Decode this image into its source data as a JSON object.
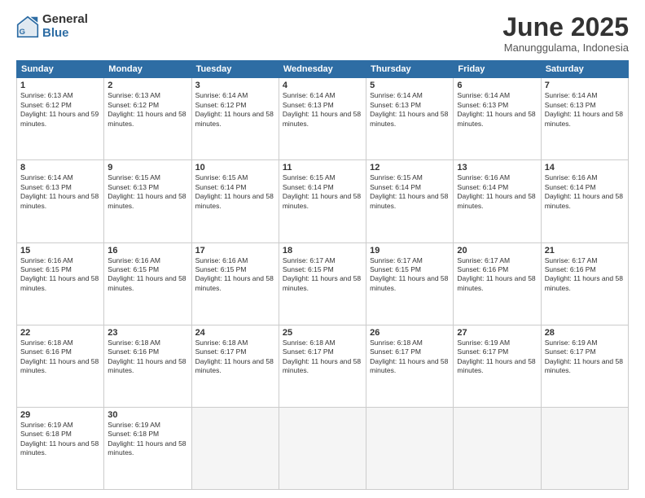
{
  "logo": {
    "general": "General",
    "blue": "Blue"
  },
  "title": "June 2025",
  "location": "Manunggulama, Indonesia",
  "days_of_week": [
    "Sunday",
    "Monday",
    "Tuesday",
    "Wednesday",
    "Thursday",
    "Friday",
    "Saturday"
  ],
  "weeks": [
    [
      {
        "num": "1",
        "rise": "6:13 AM",
        "set": "6:12 PM",
        "daylight": "11 hours and 59 minutes."
      },
      {
        "num": "2",
        "rise": "6:13 AM",
        "set": "6:12 PM",
        "daylight": "11 hours and 58 minutes."
      },
      {
        "num": "3",
        "rise": "6:14 AM",
        "set": "6:12 PM",
        "daylight": "11 hours and 58 minutes."
      },
      {
        "num": "4",
        "rise": "6:14 AM",
        "set": "6:13 PM",
        "daylight": "11 hours and 58 minutes."
      },
      {
        "num": "5",
        "rise": "6:14 AM",
        "set": "6:13 PM",
        "daylight": "11 hours and 58 minutes."
      },
      {
        "num": "6",
        "rise": "6:14 AM",
        "set": "6:13 PM",
        "daylight": "11 hours and 58 minutes."
      },
      {
        "num": "7",
        "rise": "6:14 AM",
        "set": "6:13 PM",
        "daylight": "11 hours and 58 minutes."
      }
    ],
    [
      {
        "num": "8",
        "rise": "6:14 AM",
        "set": "6:13 PM",
        "daylight": "11 hours and 58 minutes."
      },
      {
        "num": "9",
        "rise": "6:15 AM",
        "set": "6:13 PM",
        "daylight": "11 hours and 58 minutes."
      },
      {
        "num": "10",
        "rise": "6:15 AM",
        "set": "6:14 PM",
        "daylight": "11 hours and 58 minutes."
      },
      {
        "num": "11",
        "rise": "6:15 AM",
        "set": "6:14 PM",
        "daylight": "11 hours and 58 minutes."
      },
      {
        "num": "12",
        "rise": "6:15 AM",
        "set": "6:14 PM",
        "daylight": "11 hours and 58 minutes."
      },
      {
        "num": "13",
        "rise": "6:16 AM",
        "set": "6:14 PM",
        "daylight": "11 hours and 58 minutes."
      },
      {
        "num": "14",
        "rise": "6:16 AM",
        "set": "6:14 PM",
        "daylight": "11 hours and 58 minutes."
      }
    ],
    [
      {
        "num": "15",
        "rise": "6:16 AM",
        "set": "6:15 PM",
        "daylight": "11 hours and 58 minutes."
      },
      {
        "num": "16",
        "rise": "6:16 AM",
        "set": "6:15 PM",
        "daylight": "11 hours and 58 minutes."
      },
      {
        "num": "17",
        "rise": "6:16 AM",
        "set": "6:15 PM",
        "daylight": "11 hours and 58 minutes."
      },
      {
        "num": "18",
        "rise": "6:17 AM",
        "set": "6:15 PM",
        "daylight": "11 hours and 58 minutes."
      },
      {
        "num": "19",
        "rise": "6:17 AM",
        "set": "6:15 PM",
        "daylight": "11 hours and 58 minutes."
      },
      {
        "num": "20",
        "rise": "6:17 AM",
        "set": "6:16 PM",
        "daylight": "11 hours and 58 minutes."
      },
      {
        "num": "21",
        "rise": "6:17 AM",
        "set": "6:16 PM",
        "daylight": "11 hours and 58 minutes."
      }
    ],
    [
      {
        "num": "22",
        "rise": "6:18 AM",
        "set": "6:16 PM",
        "daylight": "11 hours and 58 minutes."
      },
      {
        "num": "23",
        "rise": "6:18 AM",
        "set": "6:16 PM",
        "daylight": "11 hours and 58 minutes."
      },
      {
        "num": "24",
        "rise": "6:18 AM",
        "set": "6:17 PM",
        "daylight": "11 hours and 58 minutes."
      },
      {
        "num": "25",
        "rise": "6:18 AM",
        "set": "6:17 PM",
        "daylight": "11 hours and 58 minutes."
      },
      {
        "num": "26",
        "rise": "6:18 AM",
        "set": "6:17 PM",
        "daylight": "11 hours and 58 minutes."
      },
      {
        "num": "27",
        "rise": "6:19 AM",
        "set": "6:17 PM",
        "daylight": "11 hours and 58 minutes."
      },
      {
        "num": "28",
        "rise": "6:19 AM",
        "set": "6:17 PM",
        "daylight": "11 hours and 58 minutes."
      }
    ],
    [
      {
        "num": "29",
        "rise": "6:19 AM",
        "set": "6:18 PM",
        "daylight": "11 hours and 58 minutes."
      },
      {
        "num": "30",
        "rise": "6:19 AM",
        "set": "6:18 PM",
        "daylight": "11 hours and 58 minutes."
      },
      null,
      null,
      null,
      null,
      null
    ]
  ]
}
